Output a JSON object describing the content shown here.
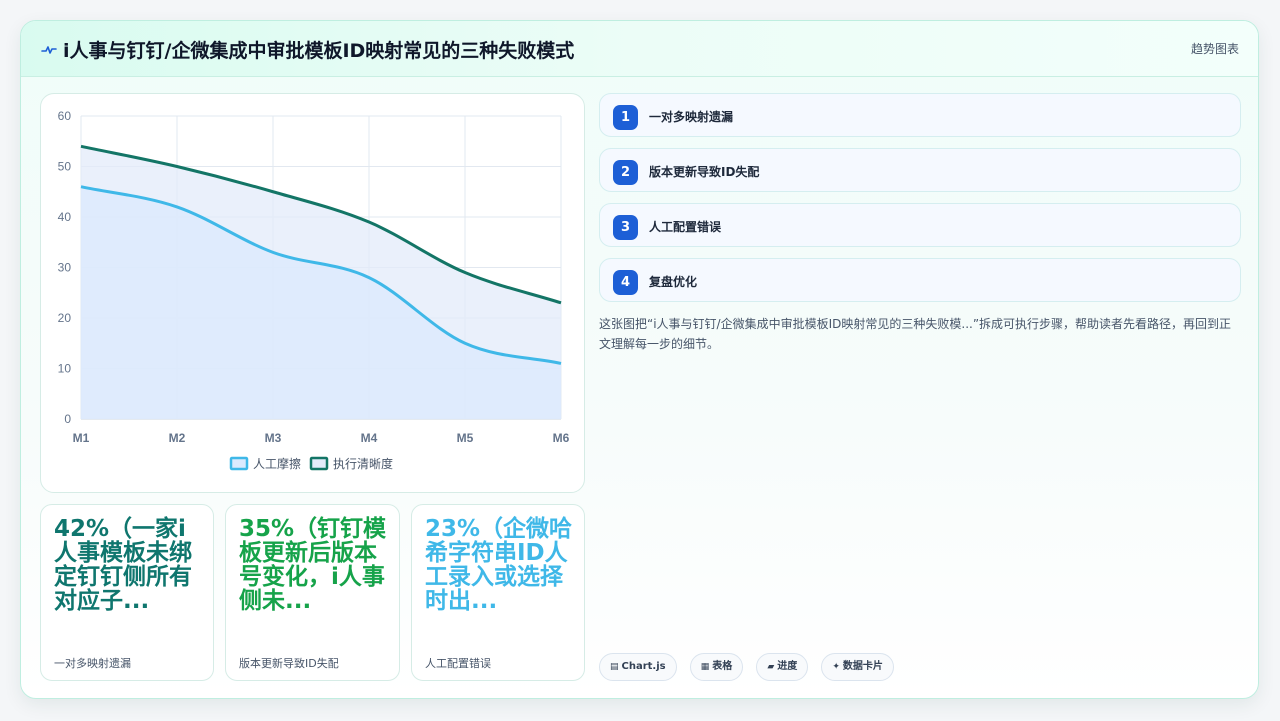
{
  "header": {
    "title": "i人事与钉钉/企微集成中审批模板ID映射常见的三种失败模式",
    "view_link": "趋势图表",
    "icon": "wave-icon"
  },
  "chart_data": {
    "type": "area",
    "x": [
      "M1",
      "M2",
      "M3",
      "M4",
      "M5",
      "M6"
    ],
    "ylim": [
      0,
      60
    ],
    "yticks": [
      0,
      10,
      20,
      30,
      40,
      50,
      60
    ],
    "grid": true,
    "legend_position": "bottom",
    "series": [
      {
        "name": "人工摩擦",
        "values": [
          46,
          42,
          33,
          28,
          15,
          11
        ],
        "color": "#3fb8e8",
        "fill": "#dbeafe"
      },
      {
        "name": "执行清晰度",
        "values": [
          54,
          50,
          45,
          39,
          29,
          23
        ],
        "color": "#137566",
        "fill": "#e3ebfa"
      }
    ]
  },
  "steps": [
    {
      "num": "1",
      "label": "一对多映射遗漏"
    },
    {
      "num": "2",
      "label": "版本更新导致ID失配"
    },
    {
      "num": "3",
      "label": "人工配置错误"
    },
    {
      "num": "4",
      "label": "复盘优化"
    }
  ],
  "description": "这张图把“i人事与钉钉/企微集成中审批模板ID映射常见的三种失败模...”拆成可执行步骤，帮助读者先看路径，再回到正文理解每一步的细节。",
  "stats": [
    {
      "value": "42%（一家i人事模板未绑定钉钉侧所有对应子...",
      "label": "一对多映射遗漏",
      "color": "#0f766e"
    },
    {
      "value": "35%（钉钉模板更新后版本号变化，i人事侧未...",
      "label": "版本更新导致ID失配",
      "color": "#16a34a"
    },
    {
      "value": "23%（企微哈希字符串ID人工录入或选择时出...",
      "label": "人工配置错误",
      "color": "#3fb8e8"
    }
  ],
  "tags": [
    {
      "icon": "chart-icon",
      "glyph": "▤",
      "label": "Chart.js"
    },
    {
      "icon": "table-icon",
      "glyph": "▦",
      "label": "表格"
    },
    {
      "icon": "progress-icon",
      "glyph": "▰",
      "label": "进度"
    },
    {
      "icon": "card-icon",
      "glyph": "✦",
      "label": "数据卡片"
    }
  ]
}
